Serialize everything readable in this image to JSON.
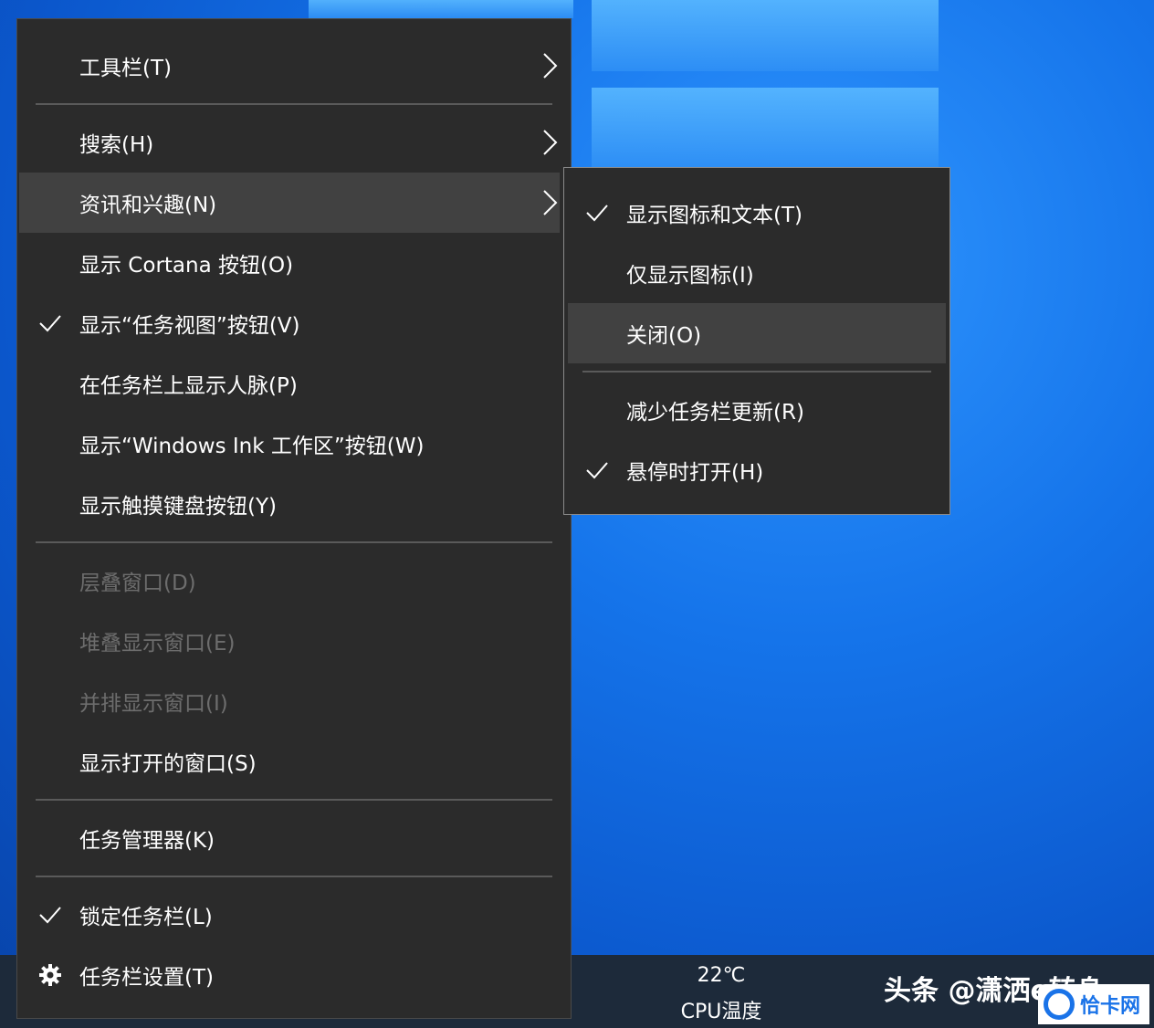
{
  "main_menu": {
    "items": [
      {
        "label": "工具栏(T)"
      },
      {
        "label": "搜索(H)"
      },
      {
        "label": "资讯和兴趣(N)"
      },
      {
        "label": "显示 Cortana 按钮(O)"
      },
      {
        "label": "显示“任务视图”按钮(V)"
      },
      {
        "label": "在任务栏上显示人脉(P)"
      },
      {
        "label": "显示“Windows Ink 工作区”按钮(W)"
      },
      {
        "label": "显示触摸键盘按钮(Y)"
      },
      {
        "label": "层叠窗口(D)"
      },
      {
        "label": "堆叠显示窗口(E)"
      },
      {
        "label": "并排显示窗口(I)"
      },
      {
        "label": "显示打开的窗口(S)"
      },
      {
        "label": "任务管理器(K)"
      },
      {
        "label": "锁定任务栏(L)"
      },
      {
        "label": "任务栏设置(T)"
      }
    ]
  },
  "submenu": {
    "items": [
      {
        "label": "显示图标和文本(T)"
      },
      {
        "label": "仅显示图标(I)"
      },
      {
        "label": "关闭(O)"
      },
      {
        "label": "减少任务栏更新(R)"
      },
      {
        "label": "悬停时打开(H)"
      }
    ]
  },
  "taskbar": {
    "temperature": "22℃",
    "temperature_label": "CPU温度"
  },
  "watermark": {
    "text": "头条 @潇洒e转身",
    "logo_text": "恰卡网"
  },
  "colors": {
    "menu_bg": "#2b2b2b",
    "highlight_bg": "#414141",
    "disabled_text": "#6d6d6d",
    "desktop_blue": "#1574ea"
  },
  "icons": [
    "chevron-right-icon",
    "checkmark-icon",
    "gear-icon"
  ]
}
